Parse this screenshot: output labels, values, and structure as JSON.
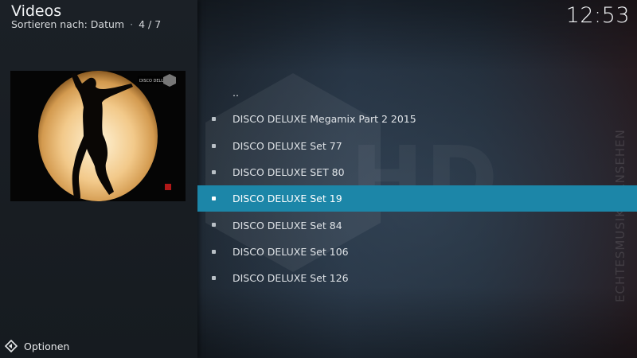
{
  "header": {
    "title": "Videos",
    "sort_label": "Sortieren nach: Datum",
    "separator": "·",
    "position": "4 / 7",
    "clock": "12:53"
  },
  "footer": {
    "options_label": "Optionen",
    "options_icon": "options-icon"
  },
  "background": {
    "watermark_text": "HD",
    "side_text": "ECHTESMUSIKFERNSEHEN"
  },
  "thumbnail": {
    "icon": "video-thumbnail",
    "overlay_text": "DISCO DELUXE"
  },
  "list": {
    "items": [
      {
        "label": "..",
        "bullet": false,
        "selected": false
      },
      {
        "label": "DISCO DELUXE Megamix Part 2 2015",
        "bullet": true,
        "selected": false
      },
      {
        "label": "DISCO DELUXE Set 77",
        "bullet": true,
        "selected": false
      },
      {
        "label": "DISCO DELUXE SET 80",
        "bullet": true,
        "selected": false
      },
      {
        "label": "DISCO DELUXE Set 19",
        "bullet": true,
        "selected": true
      },
      {
        "label": "DISCO DELUXE Set 84",
        "bullet": true,
        "selected": false
      },
      {
        "label": "DISCO DELUXE Set 106",
        "bullet": true,
        "selected": false
      },
      {
        "label": "DISCO DELUXE Set 126",
        "bullet": true,
        "selected": false
      }
    ]
  },
  "colors": {
    "selection": "#1c86a8",
    "background": "#12171d"
  }
}
